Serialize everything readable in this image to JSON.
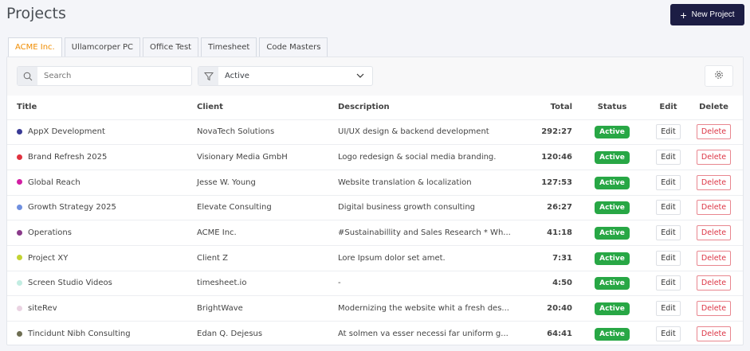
{
  "header": {
    "title": "Projects",
    "new_button": "New Project"
  },
  "tabs": [
    "ACME Inc.",
    "Ullamcorper PC",
    "Office Test",
    "Timesheet",
    "Code Masters"
  ],
  "toolbar": {
    "search_placeholder": "Search",
    "filter_value": "Active"
  },
  "columns": [
    "Title",
    "Client",
    "Description",
    "Total",
    "Status",
    "Edit",
    "Delete"
  ],
  "rows": [
    {
      "title": "AppX Development",
      "color": "#393a96",
      "client": "NovaTech Solutions",
      "description": "UI/UX design & backend development",
      "total": "292:27",
      "status": "Active"
    },
    {
      "title": "Brand Refresh 2025",
      "color": "#e0323f",
      "client": "Visionary Media GmbH",
      "description": "Logo redesign & social media branding.",
      "total": "120:46",
      "status": "Active"
    },
    {
      "title": "Global Reach",
      "color": "#d21ea3",
      "client": "Jesse W. Young",
      "description": "Website translation & localization",
      "total": "127:53",
      "status": "Active"
    },
    {
      "title": "Growth Strategy 2025",
      "color": "#6f8fdf",
      "client": "Elevate Consulting",
      "description": "Digital business growth consulting",
      "total": "26:27",
      "status": "Active"
    },
    {
      "title": "Operations",
      "color": "#8a3a8a",
      "client": "ACME Inc.",
      "description": "#Sustainabillity and Sales Research * Wh...",
      "total": "41:18",
      "status": "Active"
    },
    {
      "title": "Project XY",
      "color": "#c3d332",
      "client": "Client Z",
      "description": "Lore Ipsum dolor set amet.",
      "total": "7:31",
      "status": "Active"
    },
    {
      "title": "Screen Studio Videos",
      "color": "#c2ede2",
      "client": "timesheet.io",
      "description": "-",
      "total": "4:50",
      "status": "Active"
    },
    {
      "title": "siteRev",
      "color": "#ead3e2",
      "client": "BrightWave",
      "description": "Modernizing the website whit a fresh des...",
      "total": "20:40",
      "status": "Active"
    },
    {
      "title": "Tincidunt Nibh Consulting",
      "color": "#6e6e52",
      "client": "Edan Q. Dejesus",
      "description": "At solmen va esser necessi far uniform g...",
      "total": "64:41",
      "status": "Active"
    }
  ],
  "actions": {
    "edit": "Edit",
    "delete": "Delete"
  }
}
